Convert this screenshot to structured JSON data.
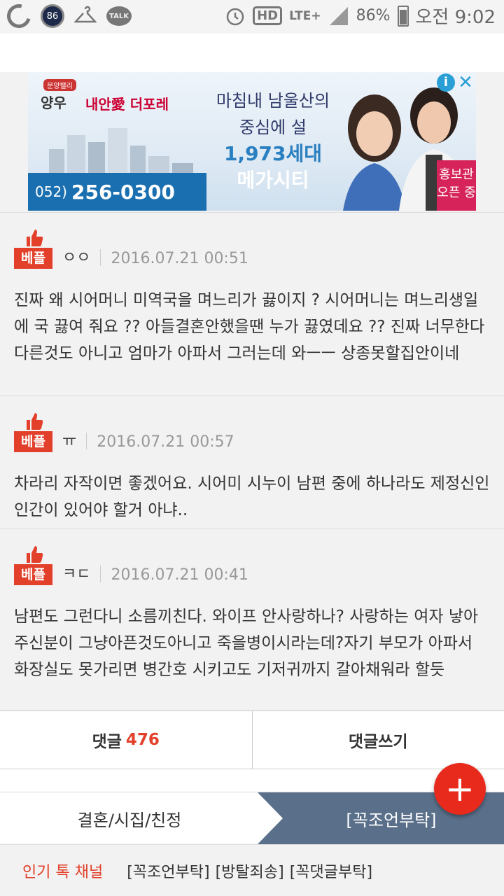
{
  "status_bar": {
    "notification_badge": "86",
    "talk_label": "TALK",
    "hd_label": "HD",
    "network_label": "LTE+",
    "battery_percent": "86%",
    "time": "오전 9:02"
  },
  "ad": {
    "brand_tag": "문양팰리",
    "brand": "양우",
    "brand_name": "내안愛 더포레",
    "headline_line1": "마침내 남울산의",
    "headline_line2": "중심에 설",
    "headline_line3": "1,973세대",
    "headline_line4": "메가시티",
    "phone_area": "052)",
    "phone_number": "256-0300",
    "open_line1": "홍보관",
    "open_line2": "오픈 중",
    "info_label": "i",
    "close_label": "✕"
  },
  "comments": [
    {
      "badge": "베플",
      "author": "ㅇㅇ",
      "date": "2016.07.21 00:51",
      "body": "진짜 왜 시어머니 미역국을 며느리가 끓이지 ? 시어머니는 며느리생일에 국 끓여 줘요 ?? 아들결혼안했을땐 누가 끓였데요 ?? 진짜 너무한다 다른것도 아니고 엄마가 아파서 그러는데 와ㅡㅡ 상종못할집안이네"
    },
    {
      "badge": "베플",
      "author": "ㅠ",
      "date": "2016.07.21 00:57",
      "body": "차라리 자작이면 좋겠어요. 시어미 시누이 남편 중에 하나라도 제정신인 인간이 있어야 할거 아냐.."
    },
    {
      "badge": "베플",
      "author": "ㅋㄷ",
      "date": "2016.07.21 00:41",
      "body": "남편도 그런다니 소름끼친다. 와이프 안사랑하나? 사랑하는 여자 낳아주신분이 그냥아픈것도아니고 죽을병이시라는데?자기 부모가 아파서 화장실도 못가리면 병간호 시키고도 기저귀까지 갈아채워라 할듯"
    }
  ],
  "actions": {
    "comments_label": "댓글",
    "comments_count": "476",
    "write_label": "댓글쓰기",
    "fab_label": "+"
  },
  "breadcrumb": {
    "category": "결혼/시집/친정",
    "current": "[꼭조언부탁]"
  },
  "popular": {
    "label": "인기 톡 채널",
    "links": [
      "[꼭조언부탁]",
      "[방탈죄송]",
      "[꼭댓글부탁]"
    ]
  },
  "colors": {
    "accent_red": "#e2402a",
    "breadcrumb_blue": "#5a6f8a",
    "fab_red": "#e82a1d"
  }
}
